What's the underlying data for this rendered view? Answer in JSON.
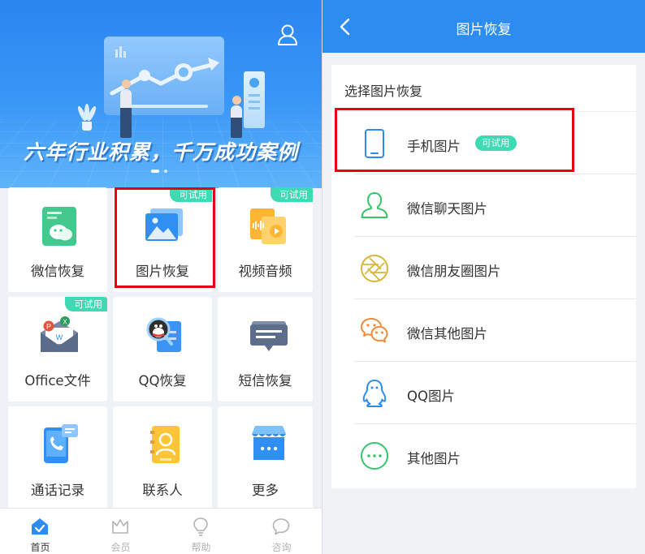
{
  "left_screen": {
    "hero": {
      "slogan": "六年行业积累，千万成功案例"
    },
    "grid": [
      {
        "label": "微信恢复",
        "icon": "wechat-recovery-icon",
        "badge": ""
      },
      {
        "label": "图片恢复",
        "icon": "image-recovery-icon",
        "badge": "可试用"
      },
      {
        "label": "视频音频",
        "icon": "video-audio-icon",
        "badge": "可试用"
      },
      {
        "label": "Office文件",
        "icon": "office-file-icon",
        "badge": "可试用"
      },
      {
        "label": "QQ恢复",
        "icon": "qq-recovery-icon",
        "badge": ""
      },
      {
        "label": "短信恢复",
        "icon": "sms-recovery-icon",
        "badge": ""
      },
      {
        "label": "通话记录",
        "icon": "call-log-icon",
        "badge": ""
      },
      {
        "label": "联系人",
        "icon": "contacts-icon",
        "badge": ""
      },
      {
        "label": "更多",
        "icon": "more-store-icon",
        "badge": ""
      }
    ],
    "tabbar": [
      {
        "label": "首页",
        "icon": "home-icon",
        "active": true
      },
      {
        "label": "会员",
        "icon": "crown-icon",
        "active": false
      },
      {
        "label": "帮助",
        "icon": "lightbulb-icon",
        "active": false
      },
      {
        "label": "咨询",
        "icon": "chat-bubble-icon",
        "active": false
      }
    ]
  },
  "right_screen": {
    "nav_title": "图片恢复",
    "section_title": "选择图片恢复",
    "rows": [
      {
        "label": "手机图片",
        "icon": "phone-icon",
        "badge": "可试用",
        "color": "#2d8cf0"
      },
      {
        "label": "微信聊天图片",
        "icon": "person-bust-icon",
        "badge": "",
        "color": "#35c66a"
      },
      {
        "label": "微信朋友圈图片",
        "icon": "aperture-icon",
        "badge": "",
        "color": "#d9b53c"
      },
      {
        "label": "微信其他图片",
        "icon": "wechat-bubbles-icon",
        "badge": "",
        "color": "#f08a3c"
      },
      {
        "label": "QQ图片",
        "icon": "qq-penguin-icon",
        "badge": "",
        "color": "#2d8cf0"
      },
      {
        "label": "其他图片",
        "icon": "ellipsis-bubble-icon",
        "badge": "",
        "color": "#35c66a"
      }
    ]
  },
  "colors": {
    "brand_blue": "#2d8cf0",
    "badge_teal": "#3fd9b3",
    "highlight_red": "#e60012"
  }
}
